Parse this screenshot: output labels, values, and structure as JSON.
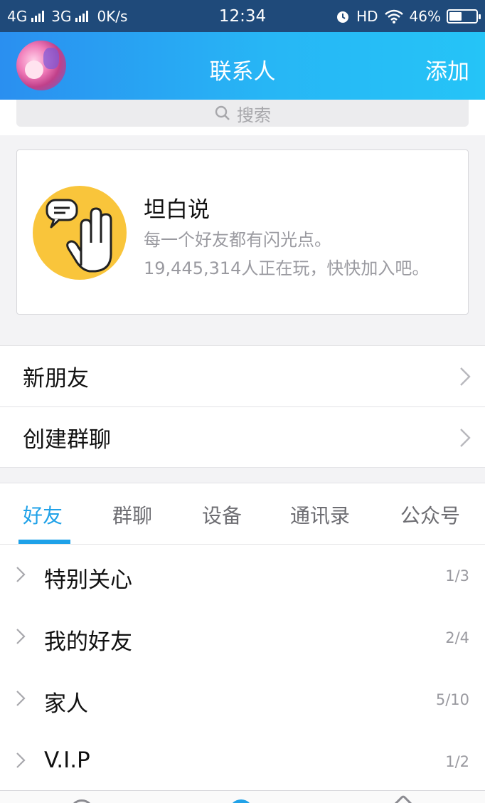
{
  "status_bar": {
    "network_1": "4G",
    "network_2": "3G",
    "speed": "0K/s",
    "time": "12:34",
    "hd": "HD",
    "battery_text": "46%",
    "battery_level": 0.46
  },
  "header": {
    "title": "联系人",
    "add_label": "添加"
  },
  "search": {
    "placeholder": "搜索"
  },
  "banner": {
    "title": "坦白说",
    "subtitle": "每一个好友都有闪光点。",
    "players": "19,445,314人正在玩，快快加入吧。"
  },
  "menu": {
    "new_friends": "新朋友",
    "create_group": "创建群聊"
  },
  "tabs": [
    {
      "label": "好友",
      "active": true
    },
    {
      "label": "群聊",
      "active": false
    },
    {
      "label": "设备",
      "active": false
    },
    {
      "label": "通讯录",
      "active": false
    },
    {
      "label": "公众号",
      "active": false
    }
  ],
  "groups": [
    {
      "name": "特别关心",
      "count": "1/3"
    },
    {
      "name": "我的好友",
      "count": "2/4"
    },
    {
      "name": "家人",
      "count": "5/10"
    },
    {
      "name": "V.I.P",
      "count": "1/2"
    }
  ],
  "colors": {
    "accent": "#21a2e8",
    "header_start": "#2a8ff0",
    "header_end": "#25c4f7"
  }
}
